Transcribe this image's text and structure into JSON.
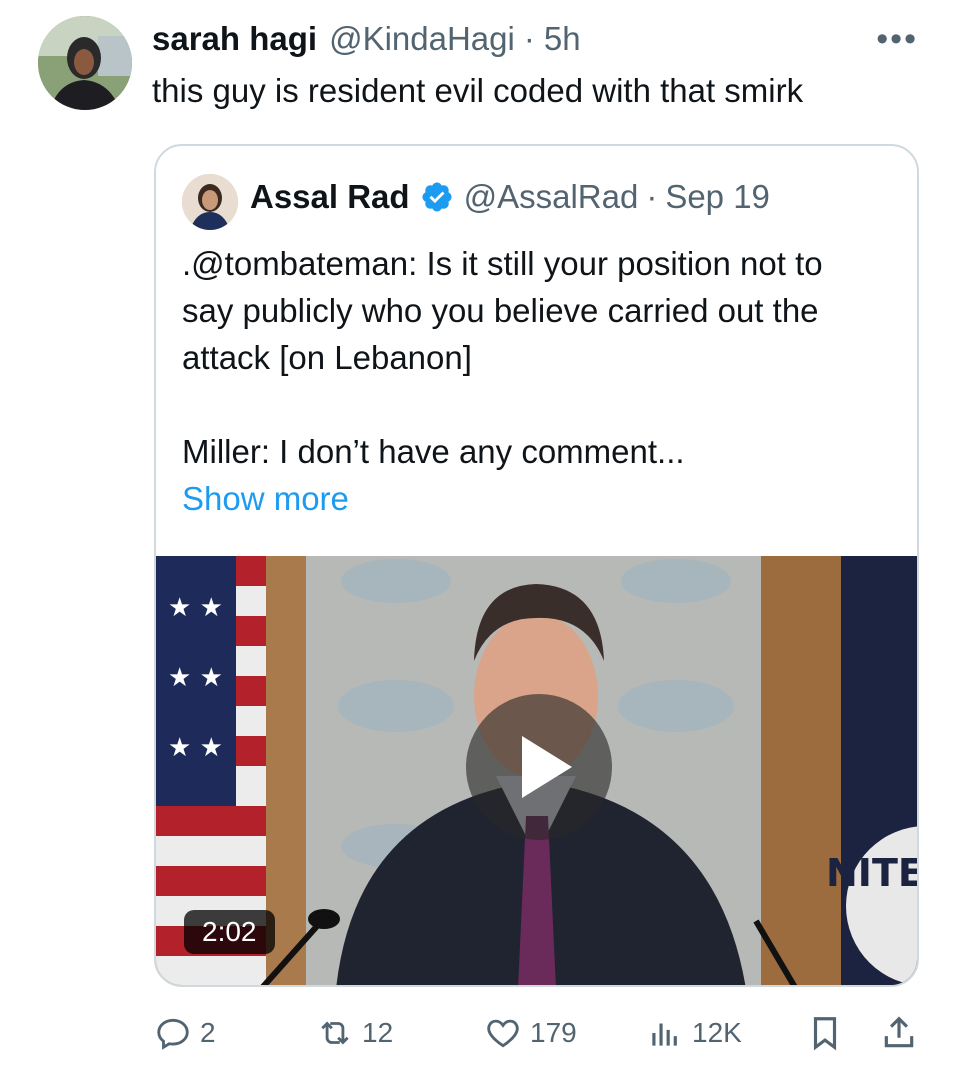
{
  "tweet": {
    "author_name": "sarah hagi",
    "author_handle": "@KindaHagi",
    "time": "5h",
    "more_label": "•••",
    "text": "this guy is resident evil coded with that smirk"
  },
  "quoted": {
    "author_name": "Assal Rad",
    "author_handle": "@AssalRad",
    "date": "Sep 19",
    "verified_color": "#1d9bf0",
    "lines": [
      ".@tombateman: Is it still your position not to",
      "say publicly who you believe carried out the",
      "attack [on Lebanon]"
    ],
    "line2": "Miller: I don’t have any comment...",
    "show_more": "Show more",
    "video": {
      "duration": "2:02",
      "seal_text": "NITED"
    }
  },
  "actions": {
    "replies": "2",
    "reposts": "12",
    "likes": "179",
    "views": "12K"
  },
  "icons": [
    "more-icon",
    "verified-badge-icon",
    "play-icon",
    "reply-icon",
    "repost-icon",
    "like-icon",
    "views-icon",
    "bookmark-icon",
    "share-icon"
  ],
  "colors": {
    "link": "#1d9bf0",
    "secondary": "#536471",
    "border": "#cfd9de"
  }
}
